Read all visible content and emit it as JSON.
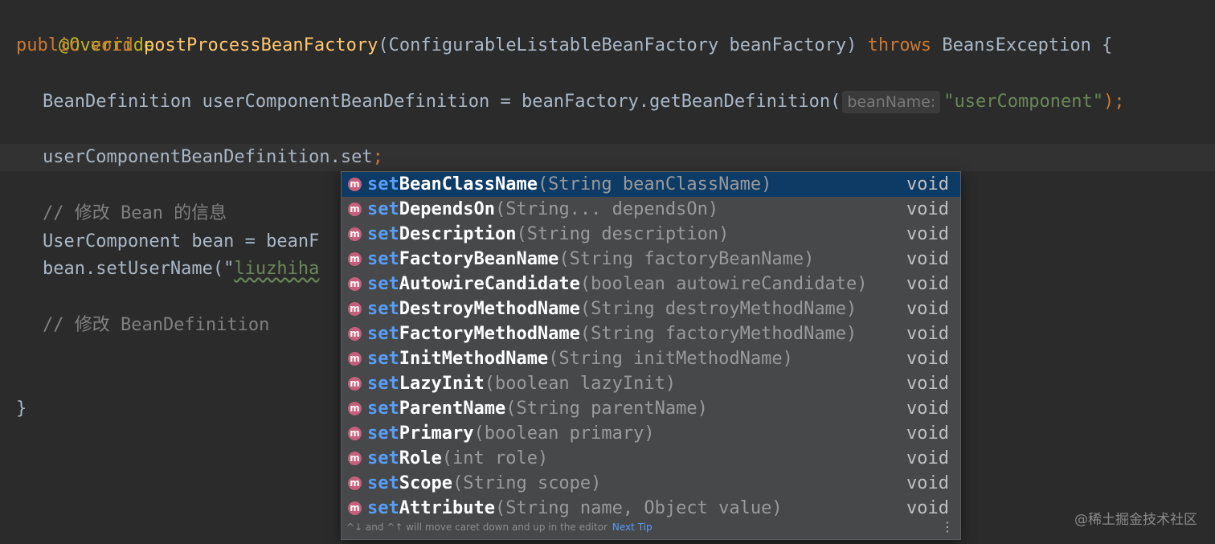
{
  "editor": {
    "line_annotation": "@Override",
    "sig": {
      "public": "public",
      "void": "void",
      "method": "postProcessBeanFactory",
      "params": "(ConfigurableListableBeanFactory beanFactory)",
      "throws": "throws",
      "exception": "BeansException {"
    },
    "l3": {
      "pre": "    BeanDefinition userComponentBeanDefinition = beanFactory.getBeanDefinition(",
      "hint": "beanName:",
      "str": "\"userComponent\"",
      "post": ");"
    },
    "l4": {
      "code": "    userComponentBeanDefinition.set",
      "semi": ";"
    },
    "l5": "    // 修改 Bean 的信息",
    "l6": "    UserComponent bean = beanF",
    "l7": {
      "pre": "    bean.setUserName(\"",
      "str": "liuzhiha"
    },
    "l8": "    // 修改 BeanDefinition",
    "closing_brace": "}"
  },
  "popup": {
    "items": [
      {
        "prefix": "set",
        "rest": "BeanClassName",
        "params": "(String beanClassName)",
        "ret": "void"
      },
      {
        "prefix": "set",
        "rest": "DependsOn",
        "params": "(String... dependsOn)",
        "ret": "void"
      },
      {
        "prefix": "set",
        "rest": "Description",
        "params": "(String description)",
        "ret": "void"
      },
      {
        "prefix": "set",
        "rest": "FactoryBeanName",
        "params": "(String factoryBeanName)",
        "ret": "void"
      },
      {
        "prefix": "set",
        "rest": "AutowireCandidate",
        "params": "(boolean autowireCandidate)",
        "ret": "void"
      },
      {
        "prefix": "set",
        "rest": "DestroyMethodName",
        "params": "(String destroyMethodName)",
        "ret": "void"
      },
      {
        "prefix": "set",
        "rest": "FactoryMethodName",
        "params": "(String factoryMethodName)",
        "ret": "void"
      },
      {
        "prefix": "set",
        "rest": "InitMethodName",
        "params": "(String initMethodName)",
        "ret": "void"
      },
      {
        "prefix": "set",
        "rest": "LazyInit",
        "params": "(boolean lazyInit)",
        "ret": "void"
      },
      {
        "prefix": "set",
        "rest": "ParentName",
        "params": "(String parentName)",
        "ret": "void"
      },
      {
        "prefix": "set",
        "rest": "Primary",
        "params": "(boolean primary)",
        "ret": "void"
      },
      {
        "prefix": "set",
        "rest": "Role",
        "params": "(int role)",
        "ret": "void"
      },
      {
        "prefix": "set",
        "rest": "Scope",
        "params": "(String scope)",
        "ret": "void"
      },
      {
        "prefix": "set",
        "rest": "Attribute",
        "params": "(String name, Object value)",
        "ret": "void"
      }
    ],
    "icon_letter": "m",
    "footer_text": "^↓ and ^↑ will move caret down and up in the editor",
    "next_tip": "Next Tip",
    "more_glyph": "⋮"
  },
  "watermark": "@稀土掘金技术社区",
  "colors": {
    "background": "#2b2b2b",
    "selection": "#0e3b66",
    "method_icon": "#c55f7b",
    "match_prefix": "#589df6"
  }
}
